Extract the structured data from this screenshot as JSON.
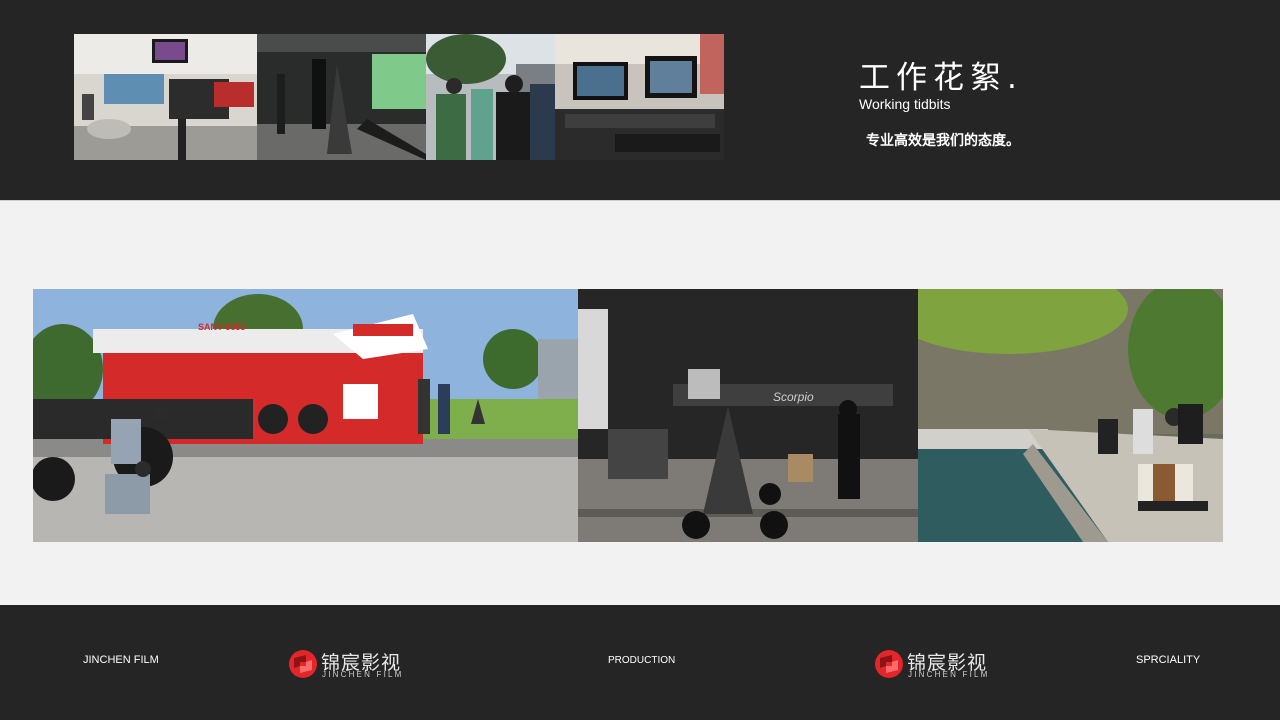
{
  "header": {
    "title_cn": "工作花絮.",
    "title_en": "Working tidbits",
    "slogan": "专业高效是我们的态度。"
  },
  "footer": {
    "left_text": "JINCHEN FILM",
    "center_text": "PRODUCTION",
    "right_text": "SPRCIALITY",
    "logo": {
      "name_cn": "锦宸影视",
      "name_en": "JINCHEN FILM",
      "mark_icon": "jinchen-logo-icon",
      "brand_color": "#e2262a"
    }
  },
  "photos": {
    "top_strip": [
      "studio-camera-rig-photo",
      "set-crew-tripod-photo",
      "crew-outdoor-photo",
      "monitor-workstation-photo"
    ],
    "gallery": [
      "fire-truck-crane-photo",
      "scorpio-crane-studio-photo",
      "riverside-dolly-photo"
    ],
    "truck_text": "SANY 8655",
    "crane_text": "Scorpio"
  },
  "colors": {
    "dark_band": "#252525",
    "light_band": "#f2f2f2"
  }
}
